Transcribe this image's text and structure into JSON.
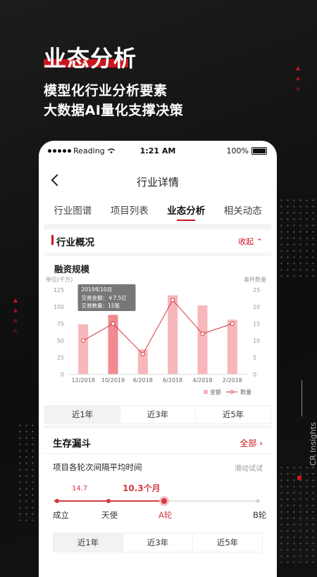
{
  "hero": {
    "title": "业态分析",
    "line1": "模型化行业分析要素",
    "line2": "大数据AI量化支撑决策",
    "side_label": "CR Insights"
  },
  "status": {
    "carrier": "Reading",
    "time": "1:21 AM",
    "battery": "100%"
  },
  "nav": {
    "title": "行业详情"
  },
  "tabs": [
    "行业图谱",
    "项目列表",
    "业态分析",
    "相关动态"
  ],
  "overview": {
    "title": "行业概况",
    "collapse": "收起"
  },
  "chart_title": "融资规模",
  "chart_data": {
    "type": "bar",
    "categories": [
      "12/2018",
      "10/2019",
      "6/2018",
      "6/2018",
      "4/2018",
      "2/2018"
    ],
    "y_left_label": "单位(千万)",
    "y_right_label": "事件数量",
    "ylim": [
      0,
      125
    ],
    "y2lim": [
      0,
      25
    ],
    "y_ticks": [
      "125",
      "100",
      "75",
      "50",
      "25",
      "0"
    ],
    "y2_ticks": [
      "25",
      "20",
      "15",
      "10",
      "5",
      "0"
    ],
    "series": [
      {
        "name": "金额",
        "type": "bar",
        "values": [
          74,
          88,
          37,
          117,
          102,
          81
        ]
      },
      {
        "name": "数量",
        "type": "line",
        "values": [
          10,
          15,
          6,
          22,
          12,
          15
        ]
      }
    ],
    "tooltip": {
      "title": "2019年10月",
      "line1": "交易金额：￥7.5亿",
      "line2": "交易数量：15笔"
    },
    "highlight_index": 1,
    "colors": {
      "bar": "#f7b7ba",
      "bar_highlight": "#f08a90",
      "line": "#d23a42",
      "tooltip": "#777777"
    }
  },
  "periods1": [
    "近1年",
    "近3年",
    "近5年"
  ],
  "funnel": {
    "title": "生存漏斗",
    "all": "全部",
    "subtitle": "项目各轮次间隔平均时间",
    "hint": "滑动试试",
    "stages": [
      "成立",
      "天使",
      "A轮",
      "B轮"
    ],
    "value_left": "14.7",
    "value_main": "10.3个月"
  },
  "periods2": [
    "近1年",
    "近3年",
    "近5年"
  ]
}
